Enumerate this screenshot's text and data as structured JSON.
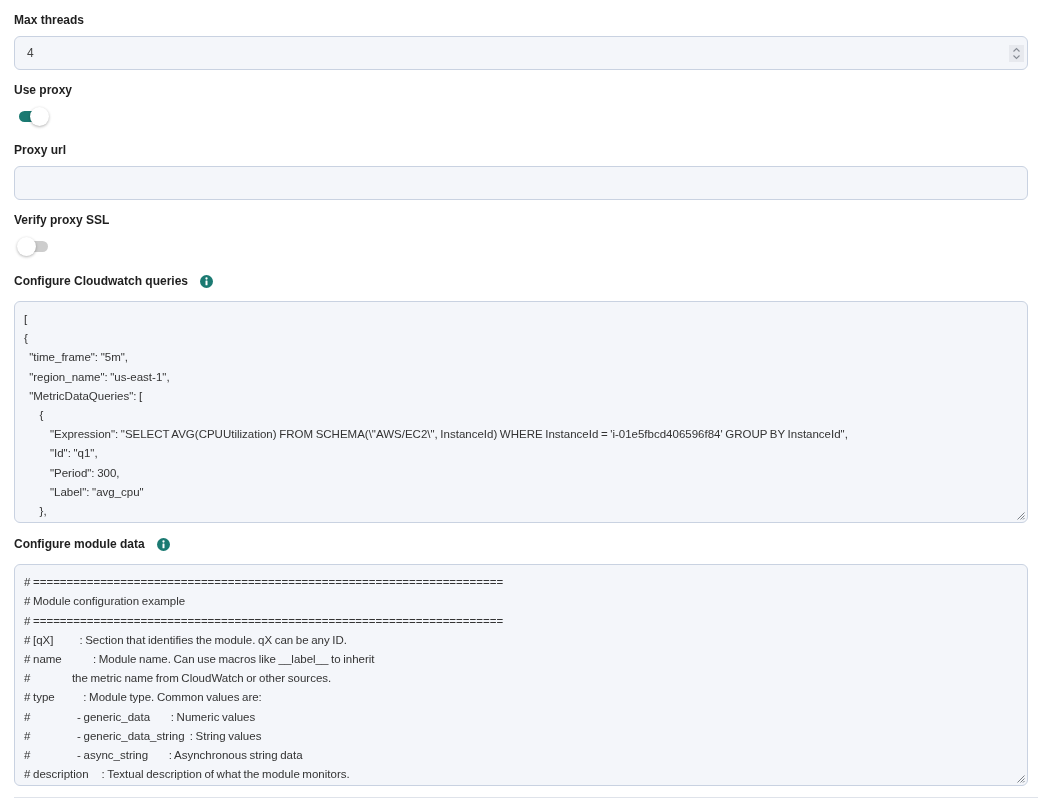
{
  "fields": [
    {
      "kind": "number",
      "label": "Max threads",
      "info": false,
      "value": "4"
    },
    {
      "kind": "toggle",
      "label": "Use proxy",
      "info": false,
      "on": true
    },
    {
      "kind": "text",
      "label": "Proxy url",
      "info": false
    },
    {
      "kind": "toggle",
      "label": "Verify proxy SSL",
      "info": false,
      "on": false
    },
    {
      "kind": "textarea",
      "label": "Configure Cloudwatch queries",
      "info": true,
      "lines": [
        "[",
        "{",
        "  \"time_frame\": \"5m\",",
        "  \"region_name\": \"us-east-1\",",
        "  \"MetricDataQueries\": [",
        "      {",
        "          \"Expression\": \"SELECT AVG(CPUUtilization) FROM SCHEMA(\\\"AWS/EC2\\\", InstanceId) WHERE InstanceId = 'i-01e5fbcd406596f84' GROUP BY InstanceId\",",
        "          \"Id\": \"q1\",",
        "          \"Period\": 300,",
        "          \"Label\": \"avg_cpu\"",
        "      },"
      ]
    },
    {
      "kind": "textarea",
      "label": "Configure module data",
      "info": true,
      "lines": [
        "# ======================================================================",
        "# Module configuration example",
        "# ======================================================================",
        "# [qX]          : Section that identifies the module. qX can be any ID.",
        "# name            : Module name. Can use macros like __label__ to inherit",
        "#                the metric name from CloudWatch or other sources.",
        "# type           : Module type. Common values are:",
        "#                  - generic_data        : Numeric values",
        "#                  - generic_data_string  : String values",
        "#                  - async_string        : Asynchronous string data",
        "# description     : Textual description of what the module monitors."
      ]
    }
  ]
}
